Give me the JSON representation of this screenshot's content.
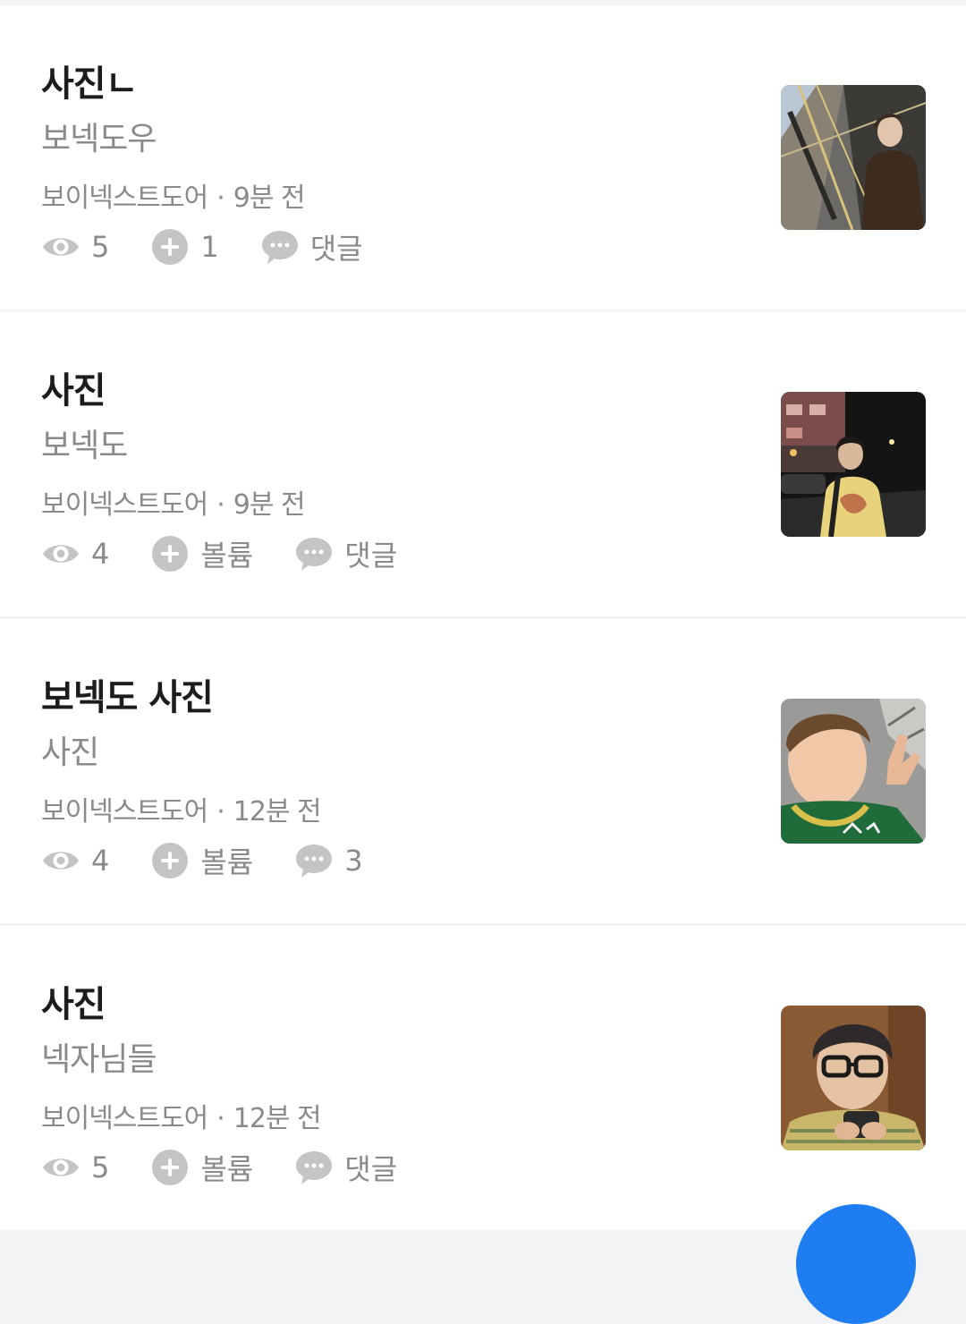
{
  "posts": [
    {
      "title": "사진ㄴ",
      "subtitle": "보넥도우",
      "board": "보이넥스트도어",
      "time": "9분 전",
      "views": "5",
      "likes": "1",
      "comments": "댓글",
      "thumbnail": "escalator-photo"
    },
    {
      "title": "사진",
      "subtitle": "보넥도",
      "board": "보이넥스트도어",
      "time": "9분 전",
      "views": "4",
      "likes": "볼륨",
      "comments": "댓글",
      "thumbnail": "night-street-photo"
    },
    {
      "title": "보넥도 사진",
      "subtitle": "사진",
      "board": "보이넥스트도어",
      "time": "12분 전",
      "views": "4",
      "likes": "볼륨",
      "comments": "3",
      "thumbnail": "selfie-photo"
    },
    {
      "title": "사진",
      "subtitle": "넥자님들",
      "board": "보이넥스트도어",
      "time": "12분 전",
      "views": "5",
      "likes": "볼륨",
      "comments": "댓글",
      "thumbnail": "glasses-photo"
    }
  ],
  "meta_separator": "·",
  "icons": {
    "views": "eye-icon",
    "likes": "plus-circle-icon",
    "comments": "chat-bubble-icon"
  },
  "colors": {
    "background": "#ffffff",
    "divider": "#f2f3f5",
    "text_primary": "#1c1c1c",
    "text_secondary": "#8a8a8a",
    "icon": "#c4c4c4",
    "fab": "#1e7df0"
  }
}
